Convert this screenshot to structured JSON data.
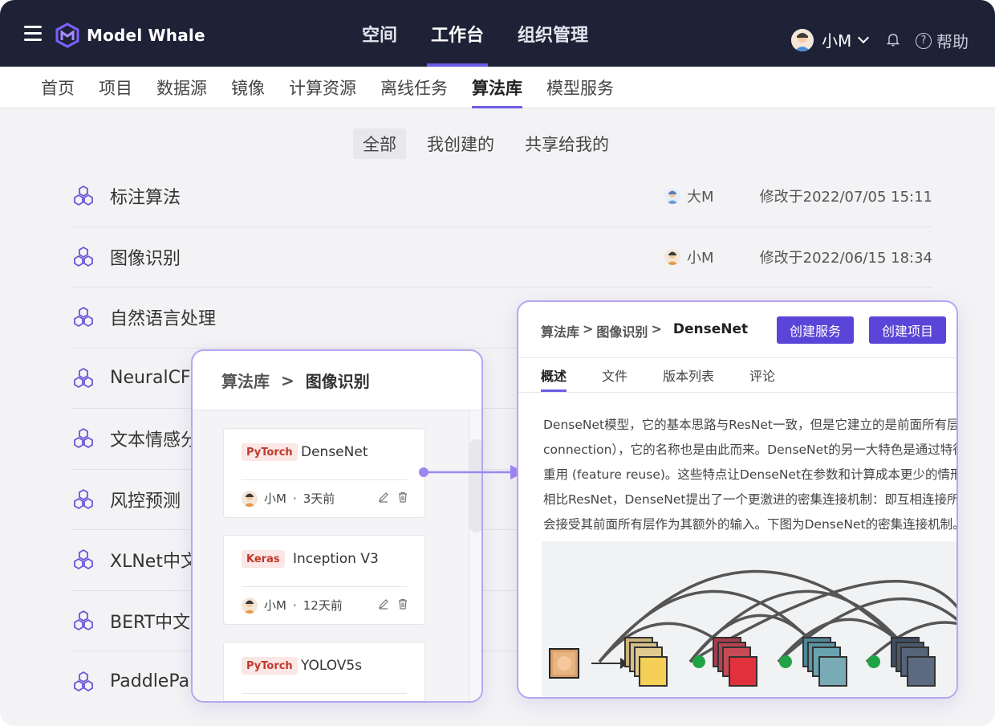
{
  "brand": {
    "name": "Model Whale",
    "accent": "#6c5ce7",
    "topbar_bg": "#1e2236"
  },
  "main_nav": [
    {
      "label": "空间",
      "active": false
    },
    {
      "label": "工作台",
      "active": true
    },
    {
      "label": "组织管理",
      "active": false
    }
  ],
  "user": {
    "name": "小M",
    "help": "帮助"
  },
  "sub_nav": [
    {
      "label": "首页",
      "active": false
    },
    {
      "label": "项目",
      "active": false
    },
    {
      "label": "数据源",
      "active": false
    },
    {
      "label": "镜像",
      "active": false
    },
    {
      "label": "计算资源",
      "active": false
    },
    {
      "label": "离线任务",
      "active": false
    },
    {
      "label": "算法库",
      "active": true
    },
    {
      "label": "模型服务",
      "active": false
    }
  ],
  "filters": [
    {
      "label": "全部",
      "active": true
    },
    {
      "label": "我创建的",
      "active": false
    },
    {
      "label": "共享给我的",
      "active": false
    }
  ],
  "algorithms": [
    {
      "title": "标注算法",
      "owner": "大M",
      "modified": "修改于2022/07/05 15:11"
    },
    {
      "title": "图像识别",
      "owner": "小M",
      "modified": "修改于2022/06/15 18:34"
    },
    {
      "title": "自然语言处理"
    },
    {
      "title": "NeuralCF"
    },
    {
      "title": "文本情感分"
    },
    {
      "title": "风控预测"
    },
    {
      "title": "XLNet中文"
    },
    {
      "title": "BERT中文"
    },
    {
      "title": "PaddlePa"
    }
  ],
  "left_card": {
    "crumb_root": "算法库",
    "crumb_sep": ">",
    "crumb_current": "图像识别",
    "items": [
      {
        "tag": "PyTorch",
        "name": "DenseNet",
        "owner": "小M",
        "dot": "·",
        "time": "3天前"
      },
      {
        "tag": "Keras",
        "name": "Inception V3",
        "owner": "小M",
        "dot": "·",
        "time": "12天前"
      },
      {
        "tag": "PyTorch",
        "name": "YOLOV5s"
      }
    ]
  },
  "right_card": {
    "crumb": [
      "算法库",
      ">",
      "图像识别",
      ">"
    ],
    "current": "DenseNet",
    "buttons": {
      "create_service": "创建服务",
      "create_project": "创建项目"
    },
    "tabs": [
      {
        "label": "概述",
        "active": true
      },
      {
        "label": "文件",
        "active": false
      },
      {
        "label": "版本列表",
        "active": false
      },
      {
        "label": "评论",
        "active": false
      }
    ],
    "paragraphs": [
      [
        "DenseNet模型，它的基本思路与ResNet一致，但是它建立的是前面所有层与",
        "connection），它的名称也是由此而来。DenseNet的另一大特色是通过特征",
        "重用 (feature reuse)。这些特点让DenseNet在参数和计算成本更少的情形下"
      ],
      [
        "相比ResNet，DenseNet提出了一个更激进的密集连接机制：即互相连接所有",
        "会接受其前面所有层作为其额外的输入。下图为DenseNet的密集连接机制。"
      ]
    ]
  }
}
